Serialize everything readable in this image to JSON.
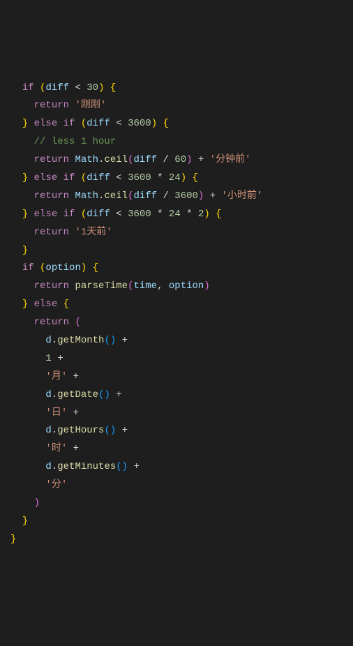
{
  "t": {
    "if": "if",
    "else": "else",
    "return": "return",
    "diff": "diff",
    "lt": "<",
    "n30": "30",
    "n3600": "3600",
    "n60": "60",
    "n24": "24",
    "n2": "2",
    "n1": "1",
    "star": "*",
    "plus": "+",
    "slash": "/",
    "cmt": "// less 1 hour",
    "s_justnow": "'刚刚'",
    "s_minago": "'分钟前'",
    "s_hrago": "'小时前'",
    "s_dayago": "'1天前'",
    "s_month": "'月'",
    "s_day": "'日'",
    "s_hour": "'时'",
    "s_minute": "'分'",
    "Math": "Math",
    "ceil": "ceil",
    "option": "option",
    "parseTime": "parseTime",
    "time": "time",
    "d": "d",
    "getMonth": "getMonth",
    "getDate": "getDate",
    "getHours": "getHours",
    "getMinutes": "getMinutes",
    "lp": "(",
    "rp": ")",
    "lb": "{",
    "rb": "}",
    "dot": ".",
    "com": ","
  }
}
